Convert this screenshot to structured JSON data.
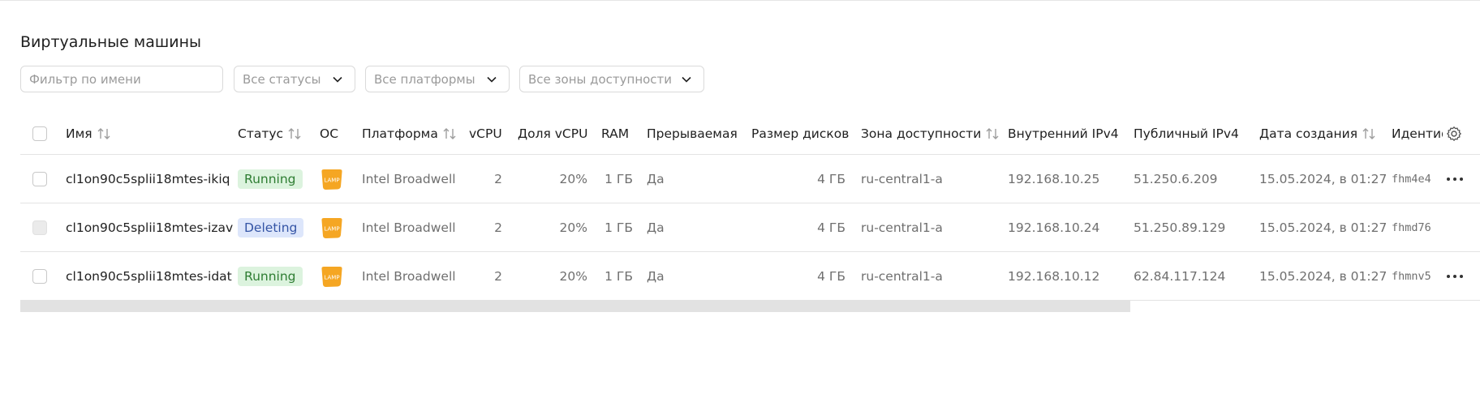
{
  "page": {
    "title": "Виртуальные машины"
  },
  "filters": {
    "name_placeholder": "Фильтр по имени",
    "status_placeholder": "Все статусы",
    "platform_placeholder": "Все платформы",
    "zone_placeholder": "Все зоны доступности"
  },
  "table": {
    "headers": {
      "name": "Имя",
      "status": "Статус",
      "os": "ОС",
      "platform": "Платформа",
      "vcpu": "vCPU",
      "vcpu_share": "Доля vCPU",
      "ram": "RAM",
      "preemptible": "Прерываемая",
      "disk_size": "Размер дисков",
      "zone": "Зона доступности",
      "internal_ip": "Внутренний IPv4",
      "public_ip": "Публичный IPv4",
      "created": "Дата создания",
      "id": "Идентификатор"
    },
    "rows": [
      {
        "name": "cl1on90c5splii18mtes-ikiq",
        "status": "Running",
        "os_icon": "lamp-icon",
        "os_label": "LAMP",
        "platform": "Intel Broadwell",
        "vcpu": "2",
        "vcpu_share": "20%",
        "ram": "1 ГБ",
        "preemptible": "Да",
        "disk_size": "4 ГБ",
        "zone": "ru-central1-a",
        "internal_ip": "192.168.10.25",
        "public_ip": "51.250.6.209",
        "created": "15.05.2024, в 01:27",
        "id": "fhm4e4"
      },
      {
        "name": "cl1on90c5splii18mtes-izav",
        "status": "Deleting",
        "os_icon": "lamp-icon",
        "os_label": "LAMP",
        "platform": "Intel Broadwell",
        "vcpu": "2",
        "vcpu_share": "20%",
        "ram": "1 ГБ",
        "preemptible": "Да",
        "disk_size": "4 ГБ",
        "zone": "ru-central1-a",
        "internal_ip": "192.168.10.24",
        "public_ip": "51.250.89.129",
        "created": "15.05.2024, в 01:27",
        "id": "fhmd76"
      },
      {
        "name": "cl1on90c5splii18mtes-idat",
        "status": "Running",
        "os_icon": "lamp-icon",
        "os_label": "LAMP",
        "platform": "Intel Broadwell",
        "vcpu": "2",
        "vcpu_share": "20%",
        "ram": "1 ГБ",
        "preemptible": "Да",
        "disk_size": "4 ГБ",
        "zone": "ru-central1-a",
        "internal_ip": "192.168.10.12",
        "public_ip": "62.84.117.124",
        "created": "15.05.2024, в 01:27",
        "id": "fhmnv5"
      }
    ]
  },
  "colors": {
    "running_bg": "#dcf3de",
    "running_text": "#2e7d32",
    "deleting_bg": "#dde6fb",
    "deleting_text": "#3454a5",
    "lamp_orange": "#f5a623"
  }
}
